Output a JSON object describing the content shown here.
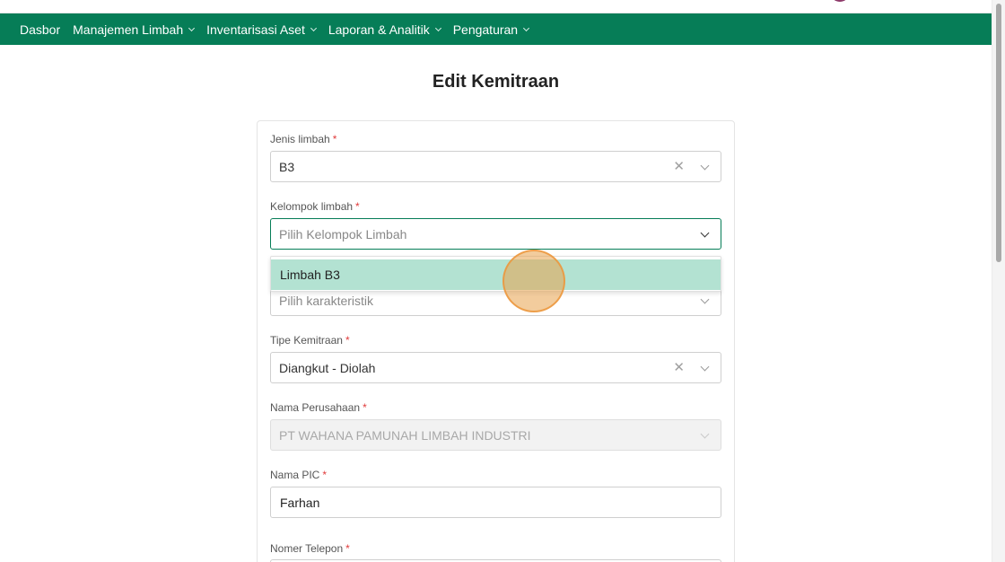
{
  "nav": {
    "items": [
      {
        "label": "Dasbor",
        "has_menu": false
      },
      {
        "label": "Manajemen Limbah",
        "has_menu": true
      },
      {
        "label": "Inventarisasi Aset",
        "has_menu": true
      },
      {
        "label": "Laporan & Analitik",
        "has_menu": true
      },
      {
        "label": "Pengaturan",
        "has_menu": true
      }
    ]
  },
  "page": {
    "title": "Edit Kemitraan"
  },
  "form": {
    "jenis_limbah": {
      "label": "Jenis limbah",
      "required": "*",
      "value": "B3"
    },
    "kelompok_limbah": {
      "label": "Kelompok limbah",
      "required": "*",
      "placeholder": "Pilih Kelompok Limbah"
    },
    "karakteristik": {
      "placeholder": "Pilih karakteristik"
    },
    "tipe_kemitraan": {
      "label": "Tipe Kemitraan",
      "required": "*",
      "value": "Diangkut - Diolah"
    },
    "nama_perusahaan": {
      "label": "Nama Perusahaan",
      "required": "*",
      "value": "PT WAHANA PAMUNAH LIMBAH INDUSTRI"
    },
    "nama_pic": {
      "label": "Nama PIC",
      "required": "*",
      "value": "Farhan"
    },
    "nomer_telepon": {
      "label": "Nomer Telepon",
      "required": "*"
    }
  },
  "dropdown": {
    "options": [
      "Limbah B3"
    ]
  },
  "colors": {
    "nav_bg": "#067d57",
    "option_highlight": "#b3e2d2",
    "required": "#e03b3b"
  }
}
